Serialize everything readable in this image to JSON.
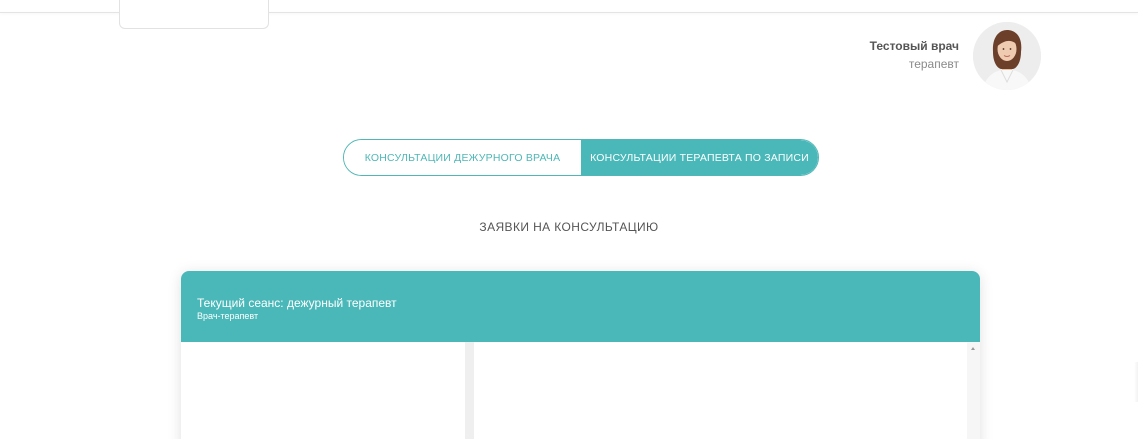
{
  "user": {
    "name": "Тестовый врач",
    "role": "терапевт"
  },
  "toggle": {
    "left_label": "КОНСУЛЬТАЦИИ ДЕЖУРНОГО ВРАЧА",
    "right_label": "КОНСУЛЬТАЦИИ ТЕРАПЕВТА ПО ЗАПИСИ",
    "active": "right"
  },
  "section": {
    "title": "ЗАЯВКИ НА КОНСУЛЬТАЦИЮ"
  },
  "session_panel": {
    "title": "Текущий сеанс: дежурный терапевт",
    "subtitle": "Врач-терапевт"
  },
  "colors": {
    "accent": "#4ab8b9",
    "text_dark": "#555555",
    "text_muted": "#8a8a8a"
  },
  "icons": {
    "avatar": "doctor-avatar",
    "scroll_up": "scroll-up-arrow"
  }
}
